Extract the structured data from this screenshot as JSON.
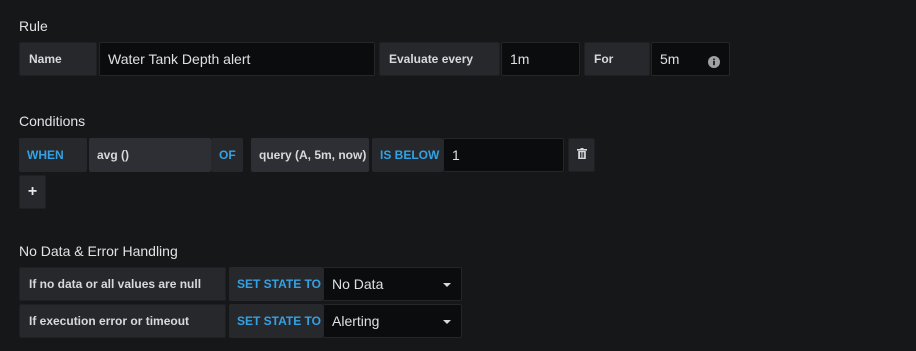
{
  "rule": {
    "section_title": "Rule",
    "name_label": "Name",
    "name_value": "Water Tank Depth alert",
    "evaluate_label": "Evaluate every",
    "evaluate_value": "1m",
    "for_label": "For",
    "for_value": "5m"
  },
  "conditions": {
    "section_title": "Conditions",
    "when_label": "WHEN",
    "reducer": "avg ()",
    "of_label": "OF",
    "query": "query (A, 5m, now)",
    "evaluator_type": "IS BELOW",
    "evaluator_value": "1",
    "add_label": "+"
  },
  "no_data": {
    "section_title": "No Data & Error Handling",
    "rows": [
      {
        "label": "If no data or all values are null",
        "keyword": "SET STATE TO",
        "value": "No Data"
      },
      {
        "label": "If execution error or timeout",
        "keyword": "SET STATE TO",
        "value": "Alerting"
      }
    ]
  },
  "colors": {
    "background": "#161719",
    "keyword": "#33a2e5",
    "label_bg": "#26282c",
    "input_bg": "#0b0c0e"
  },
  "icons": {
    "info": "info-icon",
    "delete": "trash-icon"
  }
}
